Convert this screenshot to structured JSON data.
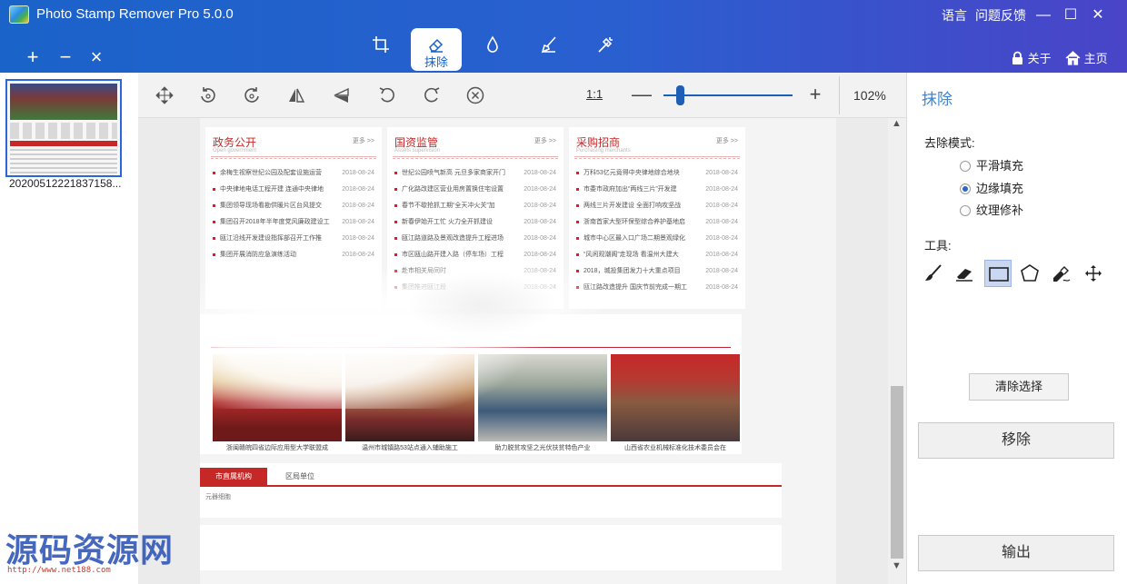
{
  "window": {
    "title": "Photo Stamp Remover Pro 5.0.0",
    "language_label": "语言",
    "feedback_label": "问题反馈",
    "minimize_glyph": "—",
    "maximize_glyph": "☐",
    "close_glyph": "✕"
  },
  "file_buttons": {
    "add": "+",
    "remove": "−",
    "clear": "×"
  },
  "mode_tabs": [
    {
      "icon": "crop-icon",
      "label": ""
    },
    {
      "icon": "eraser-icon",
      "label": "抹除"
    },
    {
      "icon": "drop-icon",
      "label": ""
    },
    {
      "icon": "brush-icon",
      "label": ""
    },
    {
      "icon": "magic-wand-icon",
      "label": ""
    }
  ],
  "header_right": {
    "about": "关于",
    "home": "主页"
  },
  "thumbnail": {
    "filename": "20200512221837158..."
  },
  "toolbar": {
    "tools": [
      "move-icon",
      "rotate-left-icon",
      "rotate-right-icon",
      "flip-horizontal-icon",
      "flip-vertical-icon",
      "undo-icon",
      "redo-icon",
      "cancel-icon"
    ],
    "zoom_one_to_one": "1:1",
    "zoom_minus": "—",
    "zoom_plus": "+",
    "zoom_level": 102,
    "zoom_text": "102%"
  },
  "document": {
    "cards": [
      {
        "title": "政务公开",
        "subtitle": "Open government",
        "more": "更多 >>",
        "items": [
          {
            "text": "余梅生视察世纪公园及配套设施运营",
            "date": "2018-08-24"
          },
          {
            "text": "中央律地电话工程开建 连通中央律地",
            "date": "2018-08-24"
          },
          {
            "text": "集团领导现场看勘供暖片区台风提交",
            "date": "2018-08-24"
          },
          {
            "text": "集团召开2018年半年度党风廉政建设工",
            "date": "2018-08-24"
          },
          {
            "text": "瓯江沿线开发建设指挥部召开工作推",
            "date": "2018-08-24"
          },
          {
            "text": "集团开展消防应急演练活动",
            "date": "2018-08-24"
          }
        ]
      },
      {
        "title": "国资监管",
        "subtitle": "Assets supervision",
        "more": "更多 >>",
        "items": [
          {
            "text": "世纪公园喷气新高 元旦多家商家开门",
            "date": "2018-08-24"
          },
          {
            "text": "广化路改建区营业用房置换住宅设置",
            "date": "2018-08-24"
          },
          {
            "text": "春节不歇抢抓工期“全天冲火关”加",
            "date": "2018-08-24"
          },
          {
            "text": "新春伊始开工忙 火力全开抓建设",
            "date": "2018-08-24"
          },
          {
            "text": "瓯江路道路及景观改造提升工程进场",
            "date": "2018-08-24"
          },
          {
            "text": "市区瓯山路开建入路（停车场）工程",
            "date": "2018-08-24"
          },
          {
            "text": "赴市相关局同时",
            "date": "2018-08-24"
          },
          {
            "text": "集团推进瓯江段",
            "date": "2018-08-24"
          }
        ]
      },
      {
        "title": "采购招商",
        "subtitle": "Purchasing merchants",
        "more": "更多 >>",
        "items": [
          {
            "text": "万科53亿元竟得中央律地综合地块",
            "date": "2018-08-24"
          },
          {
            "text": "市委市政府加出“两线三片”开发建",
            "date": "2018-08-24"
          },
          {
            "text": "两线三片开发建设 全面打响攻坚战",
            "date": "2018-08-24"
          },
          {
            "text": "浙南首家大型环保型综合养护基地启",
            "date": "2018-08-24"
          },
          {
            "text": "城市中心区最入口广场二期景观绿化",
            "date": "2018-08-24"
          },
          {
            "text": "“风闲观潮阁”走现场 看温州大建大",
            "date": "2018-08-24"
          },
          {
            "text": "2018，城投集团发力十大重点项目",
            "date": "2018-08-24"
          },
          {
            "text": "瓯江路改造提升 国庆节前完成一期工",
            "date": "2018-08-24"
          }
        ]
      }
    ],
    "photos": [
      {
        "caption": "浙闽赣皖四省边际应用型大学联盟成"
      },
      {
        "caption": "温州市城镇路53站点通入辅助施工"
      },
      {
        "caption": "助力脱贫攻坚之光伏扶贫特色产业"
      },
      {
        "caption": "山西省农业机械标准化技术委员会在"
      }
    ],
    "tabs": {
      "active": "市直属机构",
      "inactive": "区局单位",
      "content": "元器细胞"
    }
  },
  "right_panel": {
    "title": "抹除",
    "mode_label": "去除模式:",
    "modes": [
      {
        "label": "平滑填充",
        "selected": false
      },
      {
        "label": "边缘填充",
        "selected": true
      },
      {
        "label": "纹理修补",
        "selected": false
      }
    ],
    "tools_label": "工具:",
    "tools": [
      "brush-icon",
      "eraser-icon",
      "rectangle-select-icon",
      "polygon-select-icon",
      "magic-pen-icon",
      "move-icon"
    ],
    "selected_tool": "rectangle-select-icon",
    "clear_selection": "清除选择",
    "remove": "移除",
    "output": "输出"
  },
  "watermark": {
    "text": "源码资源网",
    "url": "http://www.net188.com"
  },
  "colors": {
    "titlebar_left": "#1a63c9",
    "titlebar_right": "#4a44c8",
    "accent": "#3d86d6",
    "doc_red": "#c62828"
  }
}
